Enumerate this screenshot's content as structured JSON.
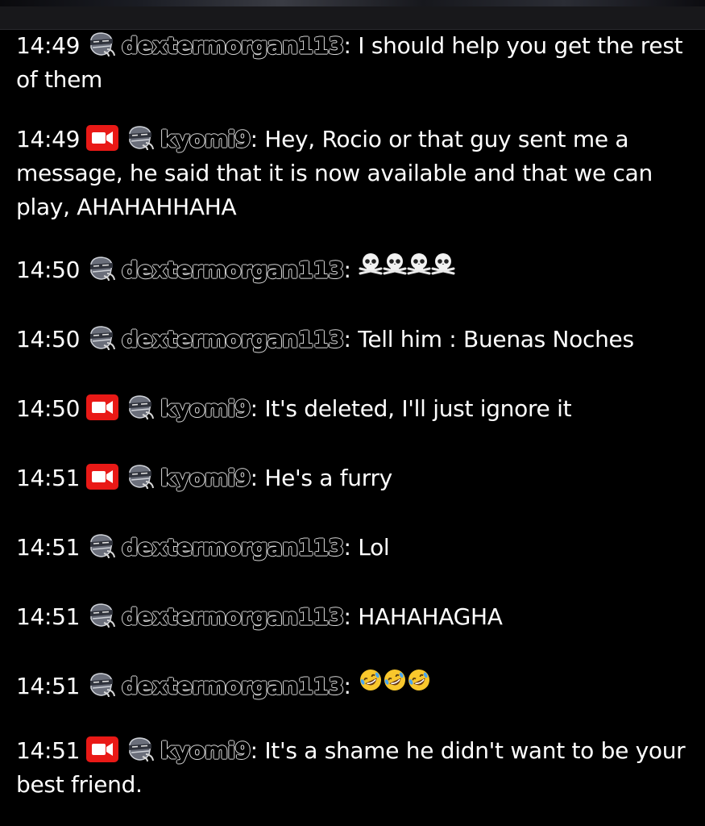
{
  "messages": [
    {
      "time": "14:49",
      "cam": false,
      "user": "dextermorgan113",
      "sep": ":",
      "text": " I should help you get the rest of them",
      "emoji": null
    },
    {
      "time": "14:49",
      "cam": true,
      "user": "kyomi9",
      "sep": ":",
      "text": " Hey, Rocio or that guy sent me a message, he said that it is now available and that we can play, AHAHAHHAHA",
      "emoji": null
    },
    {
      "time": "14:50",
      "cam": false,
      "user": "dextermorgan113",
      "sep": ":",
      "text": " ",
      "emoji": "skull"
    },
    {
      "time": "14:50",
      "cam": false,
      "user": "dextermorgan113",
      "sep": ":",
      "text": " Tell him : Buenas Noches",
      "emoji": null
    },
    {
      "time": "14:50",
      "cam": true,
      "user": "kyomi9",
      "sep": ":",
      "text": " It's deleted, I'll just ignore it",
      "emoji": null
    },
    {
      "time": "14:51",
      "cam": true,
      "user": "kyomi9",
      "sep": ":",
      "text": " He's a furry",
      "emoji": null
    },
    {
      "time": "14:51",
      "cam": false,
      "user": "dextermorgan113",
      "sep": ":",
      "text": " Lol",
      "emoji": null
    },
    {
      "time": "14:51",
      "cam": false,
      "user": "dextermorgan113",
      "sep": ":",
      "text": " HAHAHAGHA",
      "emoji": null
    },
    {
      "time": "14:51",
      "cam": false,
      "user": "dextermorgan113",
      "sep": ":",
      "text": " ",
      "emoji": "rofl"
    },
    {
      "time": "14:51",
      "cam": true,
      "user": "kyomi9",
      "sep": ":",
      "text": " It's a shame he didn't want to be your best friend.",
      "emoji": null
    }
  ],
  "emoji_counts": {
    "skull": 4,
    "rofl": 3
  },
  "badges": {
    "cam": "camera-icon",
    "mod": "masked-avatar-icon"
  },
  "colors": {
    "background": "#000000",
    "text": "#ffffff",
    "cam_badge": "#e91916",
    "top_bar": "#18181b"
  }
}
